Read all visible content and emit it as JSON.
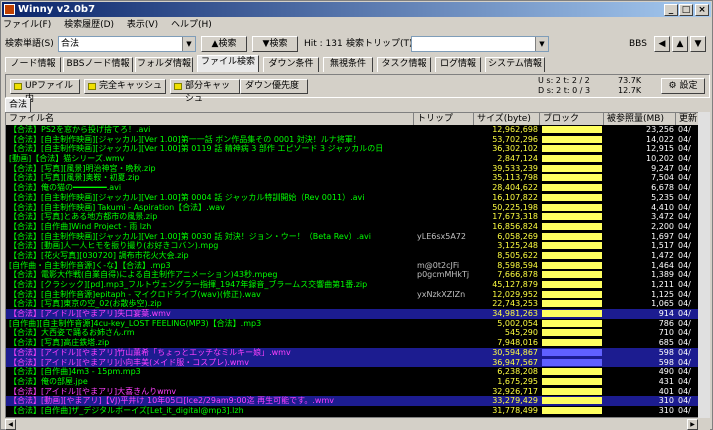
{
  "title": "Winny v2.0b7",
  "menu": [
    "ファイル(F)",
    "検索履歴(D)",
    "表示(V)",
    "ヘルプ(H)"
  ],
  "search": {
    "label": "検索単語(S)",
    "value": "合法",
    "search_button": "▲検索",
    "search_down_button": "▼検索",
    "hit": "Hit : 131",
    "trip_label": "検索トリップ(T)",
    "bbs_label": "BBS"
  },
  "tabs": [
    "ノード情報",
    "BBSノード情報",
    "フォルダ情報",
    "ファイル検索",
    "ダウン条件",
    "無視条件",
    "タスク情報",
    "ログ情報",
    "システム情報"
  ],
  "filters": [
    "UPファイル内",
    "完全キャッシュ",
    "部分キャッシュ",
    "ダウン優先度"
  ],
  "stats": {
    "up": "U s: 2 t: 2 / 2",
    "up_rate": "73.7K",
    "down": "D s: 2 t: 0 / 3",
    "down_rate": "12.7K",
    "setting": "設定"
  },
  "subtab": "合法",
  "columns": [
    "ファイル名",
    "トリップ",
    "サイズ(byte)",
    "ブロック",
    "被参照量(MB)",
    "更新日"
  ],
  "rows": [
    {
      "name": "【合法】PS2を窓から投げ捨てろ！.avi",
      "trip": "",
      "size": "12,962,698",
      "fill": 1.0,
      "ref": "23,256",
      "date": "04/",
      "color": "green",
      "sel": false
    },
    {
      "name": "【合法】[自主制作映画][ジャッカル][Ver 1.00]第一一話 ボン作品集その 0001 対決！ルナ将軍！",
      "trip": "",
      "size": "53,702,296",
      "fill": 1.0,
      "ref": "14,022",
      "date": "04/",
      "color": "green",
      "sel": false
    },
    {
      "name": "【合法】[自主制作映画][ジャッカル][Ver 1.00]第 0119 話 精神病 3 部作 エピソード 3 ジャッカルの日",
      "trip": "",
      "size": "36,302,102",
      "fill": 1.0,
      "ref": "12,915",
      "date": "04/",
      "color": "green",
      "sel": false
    },
    {
      "name": "[動画]【合法】猫シリーズ.wmv",
      "trip": "",
      "size": "2,847,124",
      "fill": 1.0,
      "ref": "10,202",
      "date": "04/",
      "color": "green",
      "sel": false
    },
    {
      "name": "【合法】[写真][風景]明治神宮・晩秋.zip",
      "trip": "",
      "size": "39,533,239",
      "fill": 1.0,
      "ref": "9,247",
      "date": "04/",
      "color": "green",
      "sel": false
    },
    {
      "name": "【合法】[写真][風景]奥鞍・初夏.zip",
      "trip": "",
      "size": "35,113,798",
      "fill": 1.0,
      "ref": "7,504",
      "date": "04/",
      "color": "green",
      "sel": false
    },
    {
      "name": "【合法】俺の猫の━━━━━━━.avi",
      "trip": "",
      "size": "28,404,622",
      "fill": 1.0,
      "ref": "6,678",
      "date": "04/",
      "color": "green",
      "sel": false
    },
    {
      "name": "【合法】[自主制作映画][ジャッカル][Ver 1.00]第 0004 話 ジャッカル特訓開始（Rev 0011）.avi",
      "trip": "",
      "size": "16,107,822",
      "fill": 1.0,
      "ref": "5,235",
      "date": "04/",
      "color": "green",
      "sel": false
    },
    {
      "name": "【合法】[自主制作映画] Takumi - Aspiration【合法】.wav",
      "trip": "",
      "size": "50,225,198",
      "fill": 1.0,
      "ref": "4,410",
      "date": "04/",
      "color": "green",
      "sel": false
    },
    {
      "name": "【合法】[写真]とある地方都市の風景.zip",
      "trip": "",
      "size": "17,673,318",
      "fill": 1.0,
      "ref": "3,472",
      "date": "04/",
      "color": "green",
      "sel": false
    },
    {
      "name": "【合法】[自作曲]Wind Project - 雨 lzh",
      "trip": "",
      "size": "16,856,824",
      "fill": 1.0,
      "ref": "2,200",
      "date": "04/",
      "color": "green",
      "sel": false
    },
    {
      "name": "【合法】[自主制作映画][ジャッカル][Ver 1.00]第 0030 話 対決！ジョン・ウー！（Beta Rev）.avi",
      "trip": "yLE6sx5A72",
      "size": "6,058,269",
      "fill": 1.0,
      "ref": "1,697",
      "date": "04/",
      "color": "green",
      "sel": false
    },
    {
      "name": "【合法】[動画]人一人ヒモを振り撮り(お好きコバン).mpg",
      "trip": "",
      "size": "3,125,248",
      "fill": 1.0,
      "ref": "1,517",
      "date": "04/",
      "color": "green",
      "sel": false
    },
    {
      "name": "【合法】[花火写真][030720] 調布市花火大会.zip",
      "trip": "",
      "size": "8,505,622",
      "fill": 1.0,
      "ref": "1,472",
      "date": "04/",
      "color": "green",
      "sel": false
    },
    {
      "name": "[自作曲・自主制作音源]く-な】【合法】.mp3",
      "trip": "m@0t2cJFi",
      "size": "8,598,594",
      "fill": 1.0,
      "ref": "1,464",
      "date": "04/",
      "color": "green",
      "sel": false
    },
    {
      "name": "【合法】電影大作戦(自業自得)による自主制作アニメーション)43秒.mpeg",
      "trip": "p0gcmMHkTj",
      "size": "7,666,878",
      "fill": 1.0,
      "ref": "1,389",
      "date": "04/",
      "color": "green",
      "sel": false
    },
    {
      "name": "【合法】[クラシック][pd].mp3_フルトヴェングラー指揮_1947年録音_ブラームス交響曲第1番.zip",
      "trip": "",
      "size": "45,127,879",
      "fill": 1.0,
      "ref": "1,211",
      "date": "04/",
      "color": "green",
      "sel": false
    },
    {
      "name": "【合法】[自主制作音源]epitaph - マイクロドライブ(wav)(修正).wav",
      "trip": "yxNzkXZIZn",
      "size": "12,029,952",
      "fill": 1.0,
      "ref": "1,125",
      "date": "04/",
      "color": "green",
      "sel": false
    },
    {
      "name": "【合法】[写真]東京の空_02(お散歩空).zip",
      "trip": "",
      "size": "22,743,253",
      "fill": 1.0,
      "ref": "1,065",
      "date": "04/",
      "color": "green",
      "sel": false
    },
    {
      "name": "【合法】[アイドル][やまアリ]失口宴葉.wmv",
      "trip": "",
      "size": "34,981,263",
      "fill": 1.0,
      "ref": "914",
      "date": "04/",
      "color": "mag",
      "sel": true
    },
    {
      "name": "[自作曲][自主制作音源]4cu-key_LOST FEELING(MP3)【合法】.mp3",
      "trip": "",
      "size": "5,002,054",
      "fill": 1.0,
      "ref": "786",
      "date": "04/",
      "color": "green",
      "sel": false
    },
    {
      "name": "【合法】大西姿で踊るお姉さん.rm",
      "trip": "",
      "size": "545,290",
      "fill": 1.0,
      "ref": "710",
      "date": "04/",
      "color": "green",
      "sel": false
    },
    {
      "name": "【合法】[写真]高庄鉄塔.zip",
      "trip": "",
      "size": "7,948,016",
      "fill": 1.0,
      "ref": "685",
      "date": "04/",
      "color": "green",
      "sel": false
    },
    {
      "name": "【合法】[アイドル][やまアリ]竹山薫希「ちょっとエッチなミルキー娘」.wmv",
      "trip": "",
      "size": "30,594,867",
      "fill": 0.0,
      "ref": "598",
      "date": "04/",
      "color": "mag",
      "sel": true
    },
    {
      "name": "【合法】[アイドル][やまアリ]小向丰美(メイド服・コスプレ).wmv",
      "trip": "",
      "size": "36,947,567",
      "fill": 0.0,
      "ref": "598",
      "date": "04/",
      "color": "mag",
      "sel": true
    },
    {
      "name": "【合法】[自作曲]4m3 - 15pm.mp3",
      "trip": "",
      "size": "6,238,208",
      "fill": 1.0,
      "ref": "490",
      "date": "04/",
      "color": "green",
      "sel": false
    },
    {
      "name": "【合法】俺の部屋.jpe",
      "trip": "",
      "size": "1,675,295",
      "fill": 1.0,
      "ref": "431",
      "date": "04/",
      "color": "green",
      "sel": false
    },
    {
      "name": "【合法】[アイドル][やまアリ]大喜きんりwmv",
      "trip": "",
      "size": "32,926,717",
      "fill": 1.0,
      "ref": "401",
      "date": "04/",
      "color": "mag",
      "sel": false
    },
    {
      "name": "【合法】[動画][やまアリ]【VJ)平井け 10年05ロ[lce2/29am9:00迄 再生可能です。.wmv",
      "trip": "",
      "size": "33,279,429",
      "fill": 1.0,
      "ref": "310",
      "date": "04/",
      "color": "mag",
      "sel": true
    },
    {
      "name": "【合法】[自作曲]ザ_デジタルボーイズ[Let_it_digital@mp3].lzh",
      "trip": "",
      "size": "31,778,499",
      "fill": 1.0,
      "ref": "310",
      "date": "04/",
      "color": "green",
      "sel": false
    }
  ]
}
